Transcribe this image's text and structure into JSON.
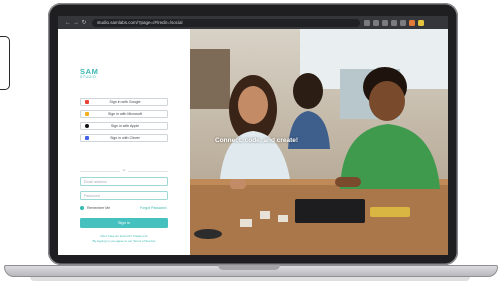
{
  "browser": {
    "url": "studio.samlabs.com/?page=/#/redir=/social"
  },
  "login": {
    "logo_main": "SAM",
    "logo_sub": "STUDIO",
    "sso_buttons": [
      {
        "label": "Sign in with Google",
        "icon": "google-icon",
        "color": "#ea4335"
      },
      {
        "label": "Sign in with Microsoft",
        "icon": "microsoft-icon",
        "color": "#f2b01e"
      },
      {
        "label": "Sign in with Apple",
        "icon": "apple-icon",
        "color": "#111111"
      },
      {
        "label": "Sign in with Clever",
        "icon": "clever-icon",
        "color": "#4361e6"
      }
    ],
    "divider_text": "or",
    "email_placeholder": "Email address",
    "password_placeholder": "Password",
    "remember_label": "Remember Me",
    "forgot_label": "Forgot Password",
    "signin_label": "Sign in",
    "footer_line1": "Don't have an account? Create one",
    "footer_line2": "By signing in you agree to our Terms of Service"
  },
  "hero": {
    "tagline": "Connect, code, and create!"
  },
  "colors": {
    "accent": "#45c2c0"
  }
}
